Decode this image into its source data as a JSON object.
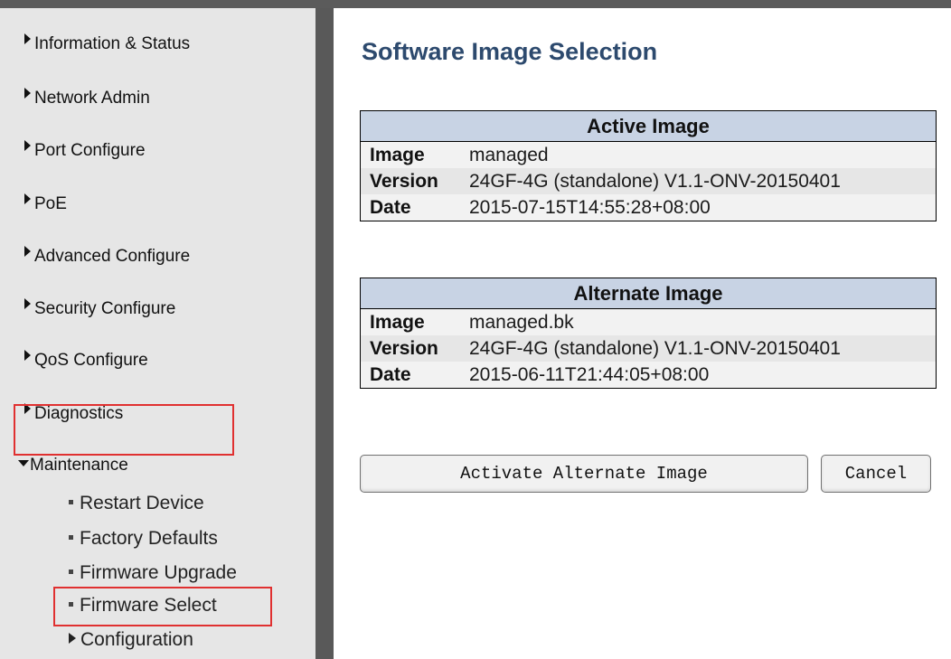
{
  "sidebar": {
    "items": [
      {
        "label": "Information & Status"
      },
      {
        "label": "Network Admin"
      },
      {
        "label": "Port Configure"
      },
      {
        "label": "PoE"
      },
      {
        "label": "Advanced Configure"
      },
      {
        "label": "Security Configure"
      },
      {
        "label": "QoS Configure"
      },
      {
        "label": "Diagnostics"
      },
      {
        "label": "Maintenance"
      }
    ],
    "sub_items": [
      {
        "label": "Restart Device"
      },
      {
        "label": "Factory Defaults"
      },
      {
        "label": "Firmware Upgrade"
      },
      {
        "label": "Firmware Select"
      },
      {
        "label": "Configuration"
      }
    ]
  },
  "main": {
    "title": "Software Image Selection",
    "active_image": {
      "header": "Active Image",
      "rows": [
        {
          "key": "Image",
          "value": "managed"
        },
        {
          "key": "Version",
          "value": "24GF-4G (standalone) V1.1-ONV-20150401"
        },
        {
          "key": "Date",
          "value": "2015-07-15T14:55:28+08:00"
        }
      ]
    },
    "alternate_image": {
      "header": "Alternate Image",
      "rows": [
        {
          "key": "Image",
          "value": "managed.bk"
        },
        {
          "key": "Version",
          "value": "24GF-4G (standalone) V1.1-ONV-20150401"
        },
        {
          "key": "Date",
          "value": "2015-06-11T21:44:05+08:00"
        }
      ]
    },
    "buttons": {
      "activate": "Activate Alternate Image",
      "cancel": "Cancel"
    }
  },
  "colors": {
    "title": "#2d4a6e",
    "table_header": "#c8d3e4",
    "highlight": "#e03030",
    "sidebar_bg": "#e6e6e6"
  }
}
